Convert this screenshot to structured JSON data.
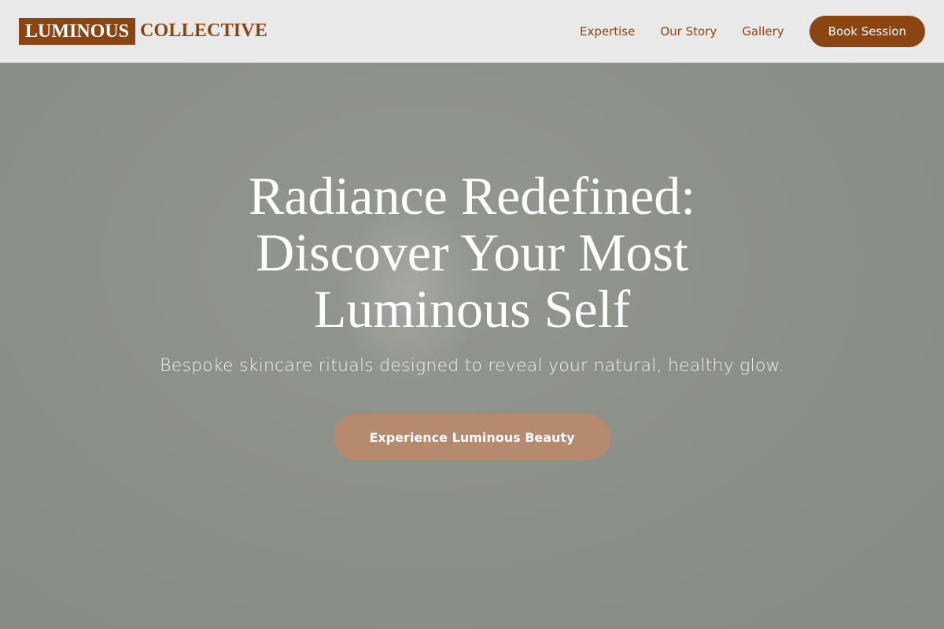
{
  "header": {
    "logo_primary": "LUMINOUS",
    "logo_secondary": "COLLECTIVE",
    "nav": [
      {
        "label": "Expertise"
      },
      {
        "label": "Our Story"
      },
      {
        "label": "Gallery"
      }
    ],
    "cta_label": "Book Session"
  },
  "hero": {
    "title": "Radiance Redefined: Discover Your Most Luminous Self",
    "subtitle": "Bespoke skincare rituals designed to reveal your natural, healthy glow.",
    "cta_label": "Experience Luminous Beauty"
  },
  "colors": {
    "brand": "#8b4513",
    "header_bg": "#e9e9e9",
    "hero_bg": "#8d928c",
    "cta_bg": "#b68a6e"
  }
}
